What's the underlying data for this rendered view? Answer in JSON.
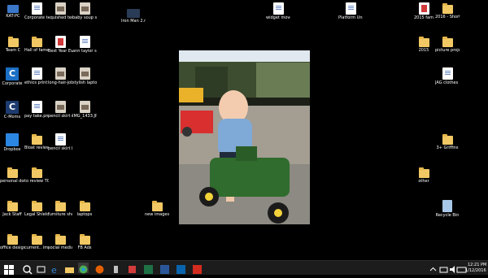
{
  "desktop": {
    "icons": [
      {
        "label": "KAT-PC"
      },
      {
        "label": "Corporate t-sheet.pptx"
      },
      {
        "label": "squished teddy"
      },
      {
        "label": "baby soup spoon.jpg"
      },
      {
        "label": "Iron Man 2.mp4"
      },
      {
        "label": "widget move.jpg"
      },
      {
        "label": "Platform University..."
      },
      {
        "label": "2015 fam"
      },
      {
        "label": "2016 - Shortcut"
      },
      {
        "label": "Team C"
      },
      {
        "label": "Hall of fame"
      },
      {
        "label": "Best Year Ever - 2016..."
      },
      {
        "label": "ann taylor sale sho..."
      },
      {
        "label": "2015"
      },
      {
        "label": "picture projects"
      },
      {
        "label": "Corporate"
      },
      {
        "label": "ethics print certification..."
      },
      {
        "label": "long-hair-job interviews.jpg"
      },
      {
        "label": "stylish laptop totes.jpg"
      },
      {
        "label": "JAG clothes - Shortcut"
      },
      {
        "label": "C-Moms"
      },
      {
        "label": "pay take.png"
      },
      {
        "label": "pencil skirt reversible.jpg"
      },
      {
        "label": "IMG_1433.JPG"
      },
      {
        "label": "Dropbox"
      },
      {
        "label": "Bloat review-C..."
      },
      {
        "label": "pencil skirt Dia Saha..."
      },
      {
        "label": "3+ Griffins"
      },
      {
        "label": "personal docs to file..."
      },
      {
        "label": "to review TODAY"
      },
      {
        "label": "other"
      },
      {
        "label": "new images"
      },
      {
        "label": "Jack Staff"
      },
      {
        "label": "Legal Shield"
      },
      {
        "label": "furniture shopping"
      },
      {
        "label": "laptops"
      },
      {
        "label": "Recycle Bin"
      },
      {
        "label": "office design"
      },
      {
        "label": "current.. imp"
      },
      {
        "label": "social media images - S..."
      },
      {
        "label": "FB Ads"
      }
    ]
  },
  "taskbar": {
    "start_icon": "windows-logo-icon",
    "search_icon": "search-icon",
    "clock_time": "12:21 PM",
    "clock_date": "1/12/2016"
  },
  "colors": {
    "taskbar": "#1c1c1c",
    "desktop": "#000000",
    "folder": "#f1c864"
  }
}
